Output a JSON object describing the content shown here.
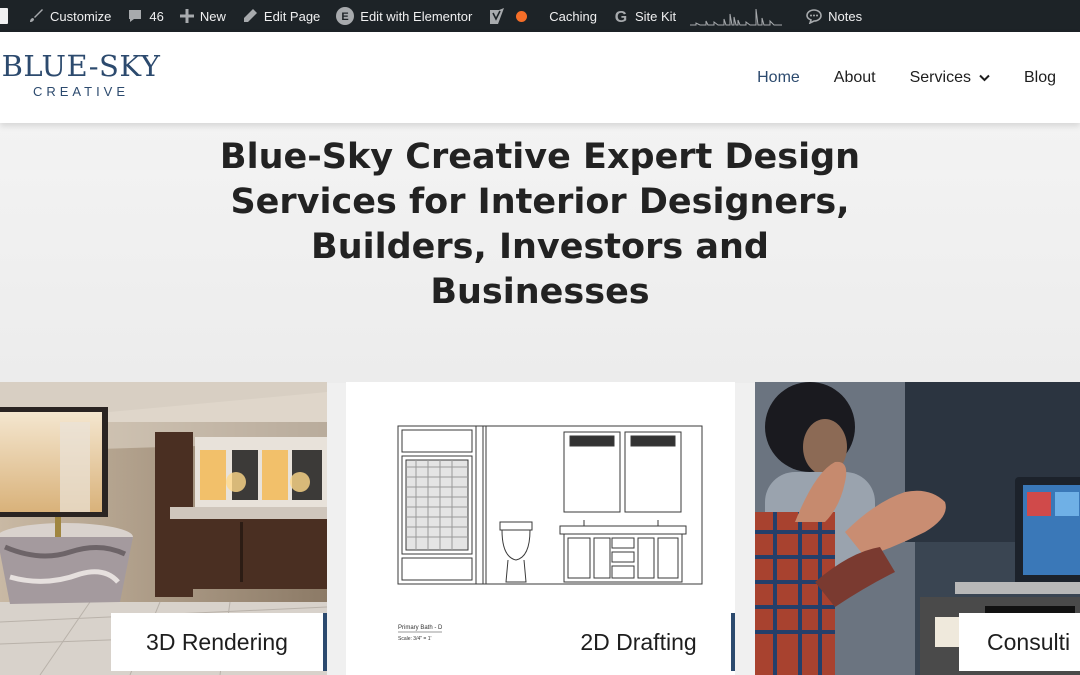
{
  "adminbar": {
    "customize": "Customize",
    "comments_count": "46",
    "new": "New",
    "edit_page": "Edit Page",
    "edit_elementor": "Edit with Elementor",
    "caching": "Caching",
    "site_kit": "Site Kit",
    "notes": "Notes",
    "elementor_letter": "E",
    "google_letter": "G"
  },
  "logo": {
    "main": "BLUE-SKY",
    "sub": "CREATIVE"
  },
  "nav": {
    "items": [
      "Home",
      "About",
      "Services",
      "Blog"
    ],
    "active": "Home"
  },
  "hero": {
    "title": "Blue-Sky Creative Expert Design Services for Interior Designers, Builders, Investors and Businesses"
  },
  "cards": [
    {
      "label": "3D Rendering"
    },
    {
      "label": "2D Drafting",
      "drawing_caption": "Primary Bath - D",
      "drawing_scale": "Scale: 3/4\" = 1'"
    },
    {
      "label": "Consulti"
    }
  ],
  "colors": {
    "brand": "#2c4a6e",
    "adminbar": "#1d2327",
    "caching_dot": "#f56e28"
  }
}
